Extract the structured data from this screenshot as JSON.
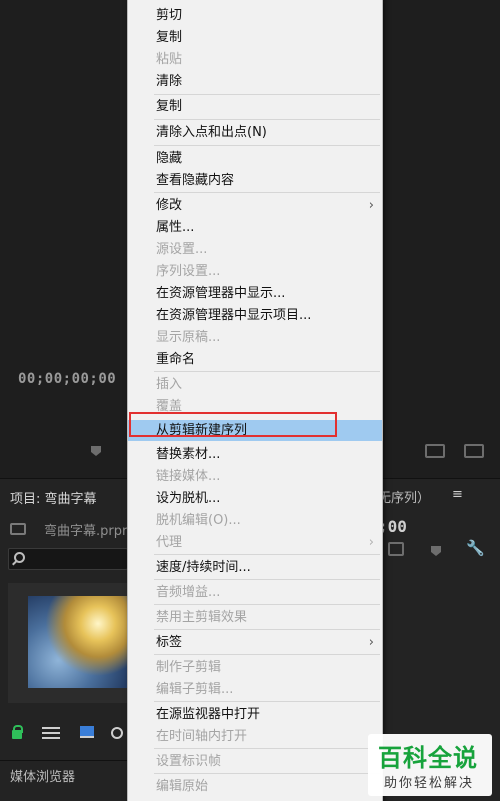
{
  "background": {
    "timecode_left": "00;00;00;00",
    "timecode_right": ";00",
    "project_title": "项目: 弯曲字幕",
    "project_file": "弯曲字幕.prpr",
    "source_label": "无序列）",
    "menu_glyph": "≡",
    "media_browser_label": "媒体浏览器"
  },
  "context_menu": {
    "items": [
      {
        "label": "剪切",
        "enabled": true
      },
      {
        "label": "复制",
        "enabled": true
      },
      {
        "label": "粘贴",
        "enabled": false
      },
      {
        "label": "清除",
        "enabled": true
      },
      {
        "label": "复制",
        "enabled": true
      },
      {
        "label": "清除入点和出点(N)",
        "enabled": true
      },
      {
        "label": "隐藏",
        "enabled": true
      },
      {
        "label": "查看隐藏内容",
        "enabled": true
      },
      {
        "label": "修改",
        "enabled": true,
        "submenu": true
      },
      {
        "label": "属性...",
        "enabled": true
      },
      {
        "label": "源设置...",
        "enabled": false
      },
      {
        "label": "序列设置...",
        "enabled": false
      },
      {
        "label": "在资源管理器中显示...",
        "enabled": true
      },
      {
        "label": "在资源管理器中显示项目...",
        "enabled": true
      },
      {
        "label": "显示原稿...",
        "enabled": false
      },
      {
        "label": "重命名",
        "enabled": true
      },
      {
        "label": "插入",
        "enabled": false
      },
      {
        "label": "覆盖",
        "enabled": false
      },
      {
        "label": "从剪辑新建序列",
        "enabled": true,
        "highlighted": true
      },
      {
        "label": "替换素材...",
        "enabled": true
      },
      {
        "label": "链接媒体...",
        "enabled": false
      },
      {
        "label": "设为脱机...",
        "enabled": true
      },
      {
        "label": "脱机编辑(O)...",
        "enabled": false
      },
      {
        "label": "代理",
        "enabled": false,
        "submenu": true
      },
      {
        "label": "速度/持续时间...",
        "enabled": true
      },
      {
        "label": "音频增益...",
        "enabled": false
      },
      {
        "label": "禁用主剪辑效果",
        "enabled": false
      },
      {
        "label": "标签",
        "enabled": true,
        "submenu": true
      },
      {
        "label": "制作子剪辑",
        "enabled": false
      },
      {
        "label": "编辑子剪辑...",
        "enabled": false
      },
      {
        "label": "在源监视器中打开",
        "enabled": true
      },
      {
        "label": "在时间轴内打开",
        "enabled": false
      },
      {
        "label": "设置标识帧",
        "enabled": false
      },
      {
        "label": "编辑原始",
        "enabled": false
      }
    ],
    "submenu_arrow": "›"
  },
  "watermark": {
    "title": "百科全说",
    "subtitle": "助你轻松解决"
  },
  "colors": {
    "menu_bg": "#f1f1f1",
    "highlight_bg": "#9fcaf0",
    "highlight_border": "#e23030",
    "watermark_green": "#17a33c"
  }
}
